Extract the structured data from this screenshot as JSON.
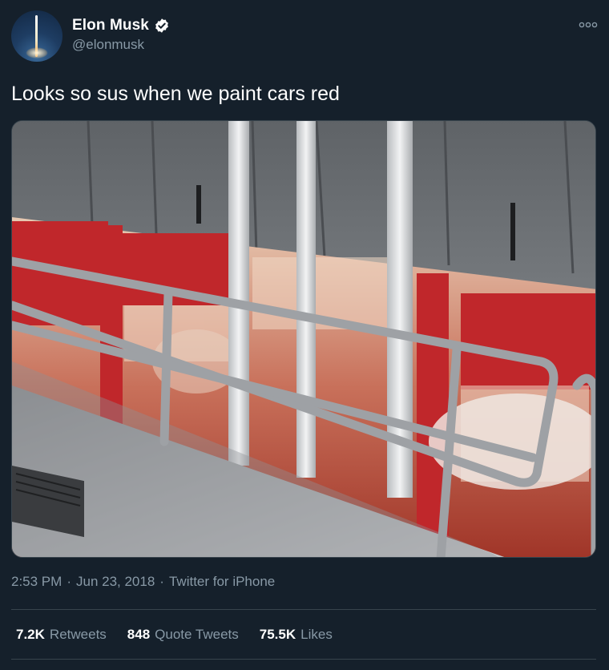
{
  "colors": {
    "background": "#15202b",
    "secondary_text": "#8899a6",
    "divider": "#38444d",
    "verified_badge": "#ffffff"
  },
  "author": {
    "display_name": "Elon Musk",
    "handle": "@elonmusk",
    "verified": true,
    "avatar_icon": "rocket-launch-avatar"
  },
  "tweet": {
    "text": "Looks so sus when we paint cars red",
    "media_description_icon": "paint-shop-photo"
  },
  "meta": {
    "time": "2:53 PM",
    "sep1": "·",
    "date": "Jun 23, 2018",
    "sep2": "·",
    "client": "Twitter for iPhone"
  },
  "stats": {
    "retweets_count": "7.2K",
    "retweets_label": "Retweets",
    "quotes_count": "848",
    "quotes_label": "Quote Tweets",
    "likes_count": "75.5K",
    "likes_label": "Likes"
  }
}
